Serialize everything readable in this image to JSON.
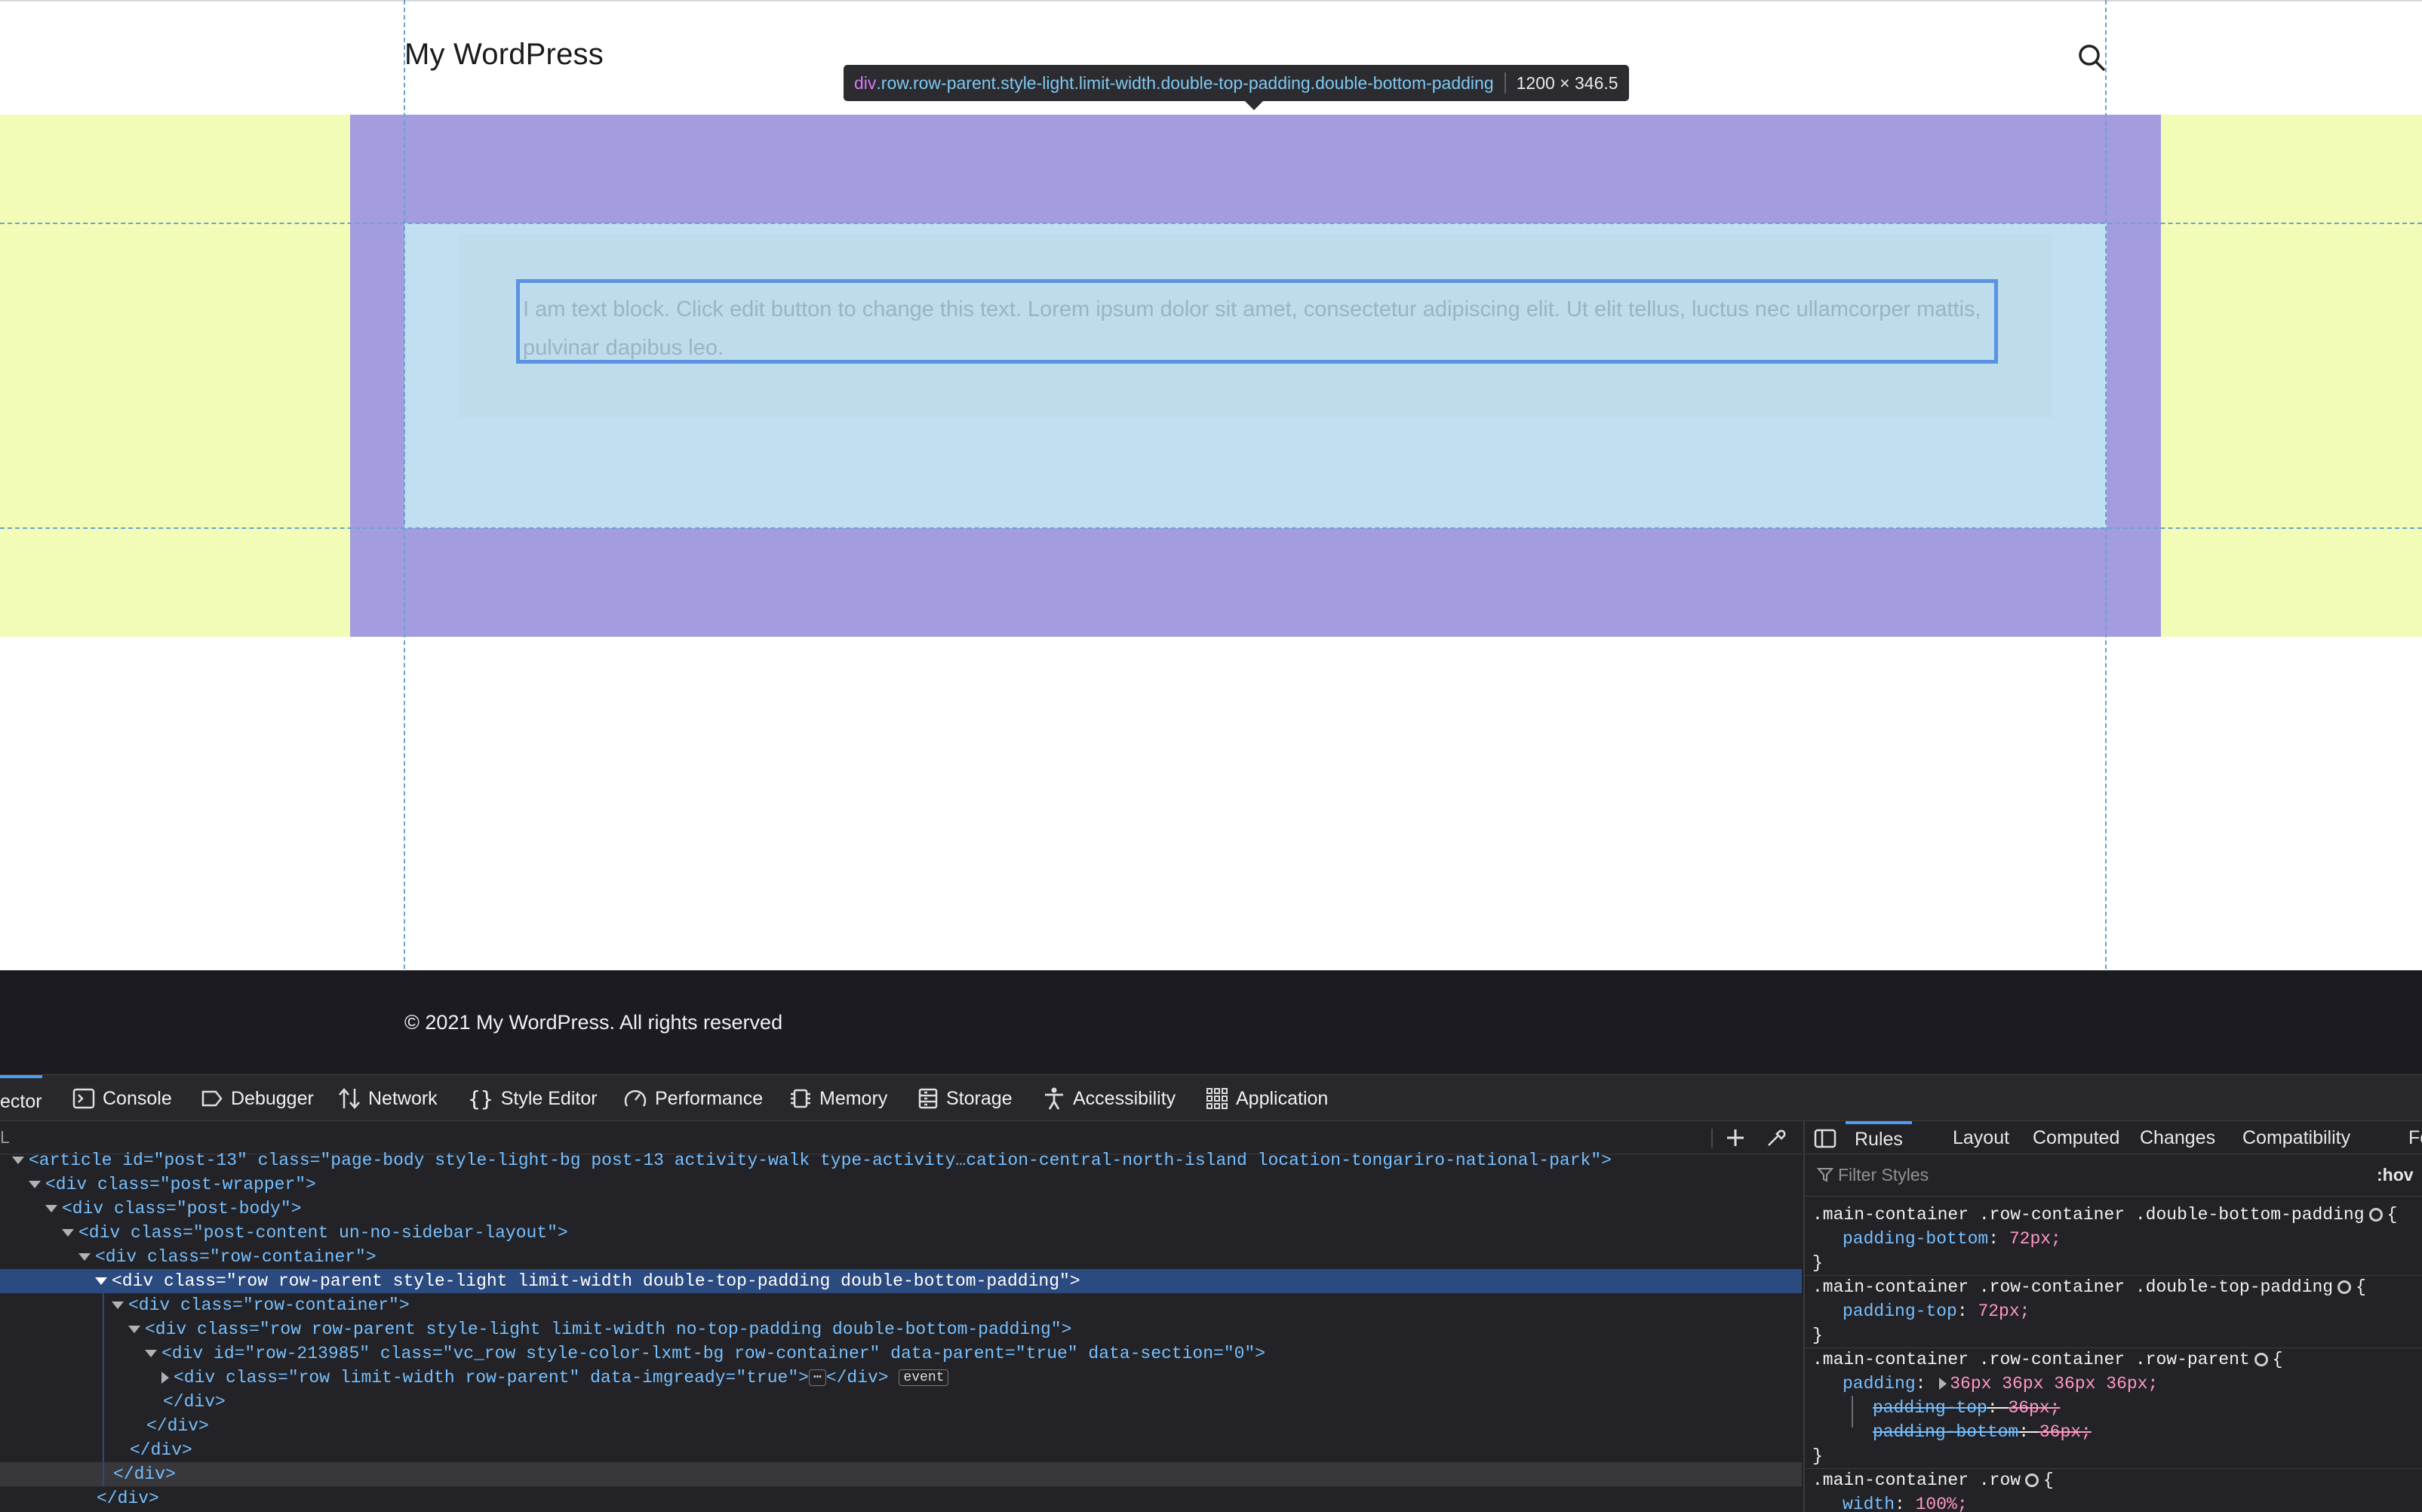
{
  "page": {
    "site_title": "My WordPress",
    "footer_text": "© 2021 My WordPress. All rights reserved",
    "row_text": "I am text block. Click edit button to change this text. Lorem ipsum dolor sit amet, consectetur adipiscing elit. Ut elit tellus, luctus nec ullamcorper mattis, pulvinar dapibus leo.",
    "tooltip": {
      "tag": "div",
      "classes": ".row.row-parent.style-light.limit-width.double-top-padding.double-bottom-padding",
      "dimensions": "1200 × 346.5"
    }
  },
  "colors": {
    "margin_overlay": "#f3fcb7",
    "padding_overlay": "#a39ddf",
    "content_overlay": "#c0dff0",
    "selection_border": "#5b93e3",
    "selected_node": "#2b4a80",
    "devtools_bg": "#232327"
  },
  "devtools": {
    "tabs": [
      {
        "label": "ector",
        "icon": "inspector-icon"
      },
      {
        "label": "Console",
        "icon": "console-icon"
      },
      {
        "label": "Debugger",
        "icon": "debugger-icon"
      },
      {
        "label": "Network",
        "icon": "network-icon"
      },
      {
        "label": "Style Editor",
        "icon": "braces-icon"
      },
      {
        "label": "Performance",
        "icon": "gauge-icon"
      },
      {
        "label": "Memory",
        "icon": "memory-chip-icon"
      },
      {
        "label": "Storage",
        "icon": "storage-icon"
      },
      {
        "label": "Accessibility",
        "icon": "accessibility-icon"
      },
      {
        "label": "Application",
        "icon": "grid-icon"
      }
    ],
    "markup_search_stub": "L",
    "markup_lines": [
      "<article id=\"post-13\" class=\"page-body style-light-bg post-13 activity-walk type-activity…cation-central-north-island location-tongariro-national-park\">",
      "<div class=\"post-wrapper\">",
      "<div class=\"post-body\">",
      "<div class=\"post-content un-no-sidebar-layout\">",
      "<div class=\"row-container\">",
      "<div class=\"row row-parent style-light limit-width double-top-padding double-bottom-padding\">",
      "<div class=\"row-container\">",
      "<div class=\"row row-parent style-light limit-width no-top-padding double-bottom-padding\">",
      "<div id=\"row-213985\" class=\"vc_row style-color-lxmt-bg row-container\" data-parent=\"true\" data-section=\"0\">",
      "<div class=\"row limit-width row-parent\" data-imgready=\"true\">",
      "</div>",
      "</div>",
      "</div>",
      "</div>",
      "</div>"
    ],
    "ellipsis_badge": "⋯",
    "event_badge": "event",
    "closing_inner": "</div>",
    "side_tabs": [
      "Rules",
      "Layout",
      "Computed",
      "Changes",
      "Compatibility",
      "Fo"
    ],
    "filter_placeholder": "Filter Styles",
    "hov_label": ":hov",
    "rules": [
      {
        "selector": ".main-container .row-container .double-bottom-padding",
        "props": [
          {
            "name": "padding-bottom",
            "value": "72px;"
          }
        ]
      },
      {
        "selector": ".main-container .row-container .double-top-padding",
        "props": [
          {
            "name": "padding-top",
            "value": "72px;"
          }
        ]
      },
      {
        "selector": ".main-container .row-container .row-parent",
        "props": [
          {
            "name": "padding",
            "value": "36px 36px 36px 36px;"
          },
          {
            "name": "padding-top",
            "value": "36px;"
          },
          {
            "name": "padding-bottom",
            "value": "36px;"
          }
        ]
      },
      {
        "selector": ".main-container .row",
        "props": [
          {
            "name": "width",
            "value": "100%;"
          }
        ]
      }
    ]
  }
}
